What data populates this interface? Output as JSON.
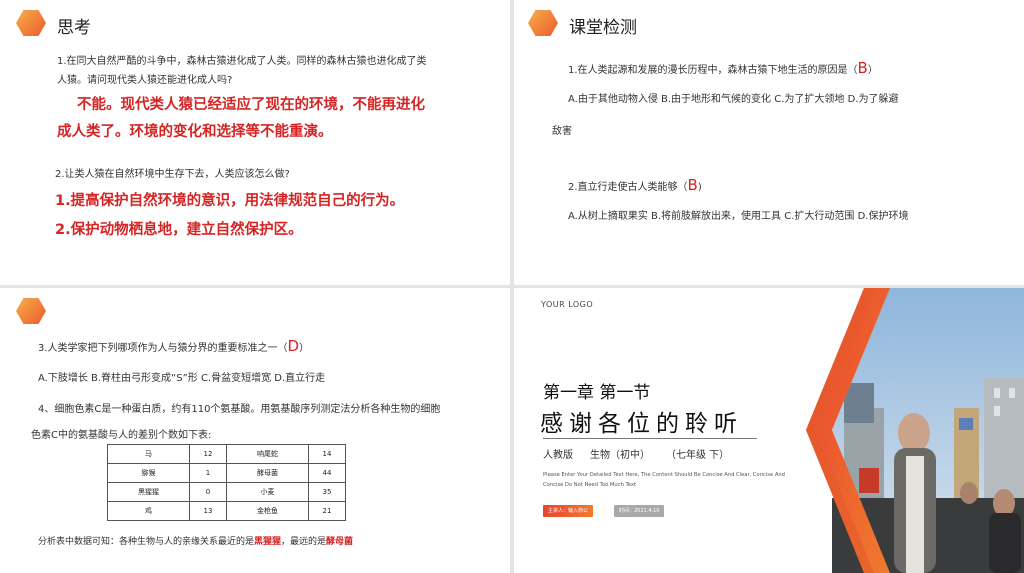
{
  "slide1": {
    "title": "思考",
    "q1_line1": "1.在同大自然严酷的斗争中，森林古猿进化成了人类。同样的森林古猿也进化成了类",
    "q1_line2": "人猿。请问现代类人猿还能进化成人吗?",
    "a1_line1": "不能。现代类人猿已经适应了现在的环境，不能再进化",
    "a1_line2": "成人类了。环境的变化和选择等不能重演。",
    "q2": "2.让类人猿在自然环境中生存下去，人类应该怎么做?",
    "a2_line1": "1.提高保护自然环境的意识，用法律规范自己的行为。",
    "a2_line2": "2.保护动物栖息地，建立自然保护区。"
  },
  "slide2": {
    "title": "课堂检测",
    "q1_pre": "1.在人类起源和发展的漫长历程中，森林古猿下地生活的原因是（",
    "q1_ans": "B",
    "q1_post": "）",
    "q1_opts": "A.由于其他动物入侵   B.由于地形和气候的变化    C.为了扩大领地         D.为了躲避",
    "q1_opts_wrap": "敌害",
    "q2_pre": "2.直立行走使古人类能够（",
    "q2_ans": "B",
    "q2_post": ")",
    "q2_opts": "A.从树上摘取果实 B.将前肢解放出来，使用工具    C.扩大行动范围      D.保护环境"
  },
  "slide3": {
    "q3_pre": "3.人类学家把下列哪项作为人与猿分界的重要标准之一（",
    "q3_ans": "D",
    "q3_post": "）",
    "q3_opts": "A.下肢增长    B.脊柱由弓形变成“S”形           C.骨盆变短增宽      D.直立行走",
    "q4_line1": "4、细胞色素C是一种蛋白质，约有110个氨基酸。用氨基酸序列测定法分析各种生物的细胞",
    "q4_line2": "色素C中的氨基酸与人的差别个数如下表:",
    "table": [
      [
        "马",
        "12",
        "响尾蛇",
        "14"
      ],
      [
        "猕猴",
        "1",
        "酵母菌",
        "44"
      ],
      [
        "黑猩猩",
        "0",
        "小麦",
        "35"
      ],
      [
        "鸡",
        "13",
        "金枪鱼",
        "21"
      ]
    ],
    "conclusion_pre": "分析表中数据可知：各种生物与人的亲缘关系最近的是",
    "conclusion_near": "黑猩猩",
    "conclusion_mid": "，最远的是",
    "conclusion_far": "酵母菌"
  },
  "slide4": {
    "logo": "YOUR  LOGO",
    "chapter": "第一章  第一节",
    "thanks": "感谢各位的聆听",
    "edition": "人教版",
    "subject": "生物（初中）",
    "grade": "（七年级  下）",
    "eng_text": "Please Enter Your Detailed Text Here, The Content Should Be Concise And Clear, Concise And Concise Do Not Need Too Much Text",
    "presenter": "主讲人：输入你公",
    "date": "时间：2021.4.10",
    "colors": {
      "orange": "#f07a2e",
      "red": "#e8452f",
      "gray": "#a9a9a9"
    }
  }
}
